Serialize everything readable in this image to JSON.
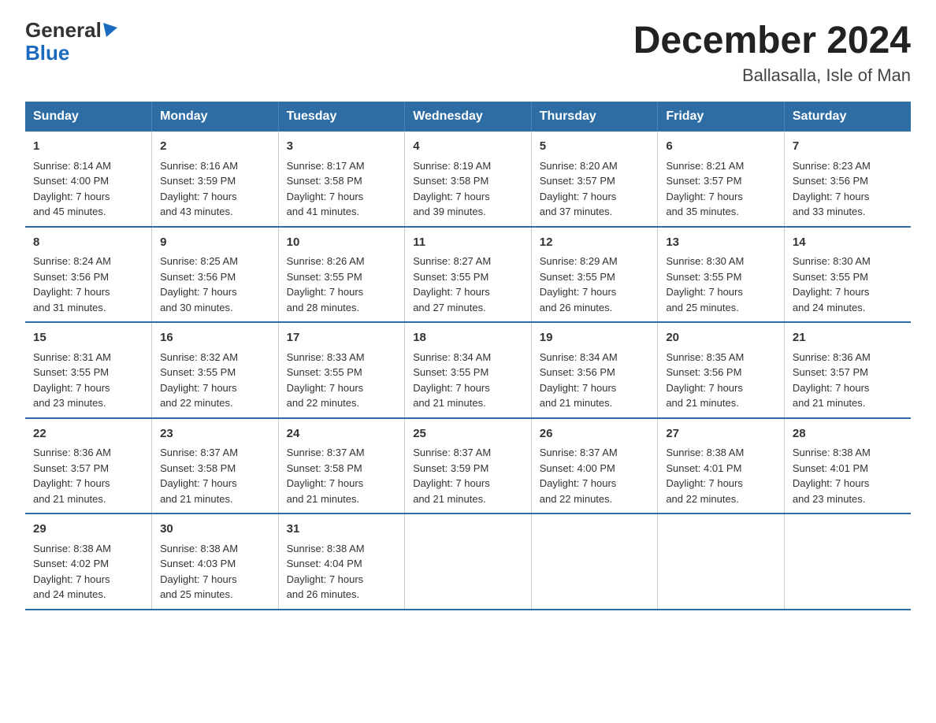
{
  "header": {
    "logo_line1": "General",
    "logo_line2": "Blue",
    "title": "December 2024",
    "location": "Ballasalla, Isle of Man"
  },
  "columns": [
    "Sunday",
    "Monday",
    "Tuesday",
    "Wednesday",
    "Thursday",
    "Friday",
    "Saturday"
  ],
  "weeks": [
    [
      {
        "day": "1",
        "sunrise": "8:14 AM",
        "sunset": "4:00 PM",
        "daylight": "7 hours and 45 minutes."
      },
      {
        "day": "2",
        "sunrise": "8:16 AM",
        "sunset": "3:59 PM",
        "daylight": "7 hours and 43 minutes."
      },
      {
        "day": "3",
        "sunrise": "8:17 AM",
        "sunset": "3:58 PM",
        "daylight": "7 hours and 41 minutes."
      },
      {
        "day": "4",
        "sunrise": "8:19 AM",
        "sunset": "3:58 PM",
        "daylight": "7 hours and 39 minutes."
      },
      {
        "day": "5",
        "sunrise": "8:20 AM",
        "sunset": "3:57 PM",
        "daylight": "7 hours and 37 minutes."
      },
      {
        "day": "6",
        "sunrise": "8:21 AM",
        "sunset": "3:57 PM",
        "daylight": "7 hours and 35 minutes."
      },
      {
        "day": "7",
        "sunrise": "8:23 AM",
        "sunset": "3:56 PM",
        "daylight": "7 hours and 33 minutes."
      }
    ],
    [
      {
        "day": "8",
        "sunrise": "8:24 AM",
        "sunset": "3:56 PM",
        "daylight": "7 hours and 31 minutes."
      },
      {
        "day": "9",
        "sunrise": "8:25 AM",
        "sunset": "3:56 PM",
        "daylight": "7 hours and 30 minutes."
      },
      {
        "day": "10",
        "sunrise": "8:26 AM",
        "sunset": "3:55 PM",
        "daylight": "7 hours and 28 minutes."
      },
      {
        "day": "11",
        "sunrise": "8:27 AM",
        "sunset": "3:55 PM",
        "daylight": "7 hours and 27 minutes."
      },
      {
        "day": "12",
        "sunrise": "8:29 AM",
        "sunset": "3:55 PM",
        "daylight": "7 hours and 26 minutes."
      },
      {
        "day": "13",
        "sunrise": "8:30 AM",
        "sunset": "3:55 PM",
        "daylight": "7 hours and 25 minutes."
      },
      {
        "day": "14",
        "sunrise": "8:30 AM",
        "sunset": "3:55 PM",
        "daylight": "7 hours and 24 minutes."
      }
    ],
    [
      {
        "day": "15",
        "sunrise": "8:31 AM",
        "sunset": "3:55 PM",
        "daylight": "7 hours and 23 minutes."
      },
      {
        "day": "16",
        "sunrise": "8:32 AM",
        "sunset": "3:55 PM",
        "daylight": "7 hours and 22 minutes."
      },
      {
        "day": "17",
        "sunrise": "8:33 AM",
        "sunset": "3:55 PM",
        "daylight": "7 hours and 22 minutes."
      },
      {
        "day": "18",
        "sunrise": "8:34 AM",
        "sunset": "3:55 PM",
        "daylight": "7 hours and 21 minutes."
      },
      {
        "day": "19",
        "sunrise": "8:34 AM",
        "sunset": "3:56 PM",
        "daylight": "7 hours and 21 minutes."
      },
      {
        "day": "20",
        "sunrise": "8:35 AM",
        "sunset": "3:56 PM",
        "daylight": "7 hours and 21 minutes."
      },
      {
        "day": "21",
        "sunrise": "8:36 AM",
        "sunset": "3:57 PM",
        "daylight": "7 hours and 21 minutes."
      }
    ],
    [
      {
        "day": "22",
        "sunrise": "8:36 AM",
        "sunset": "3:57 PM",
        "daylight": "7 hours and 21 minutes."
      },
      {
        "day": "23",
        "sunrise": "8:37 AM",
        "sunset": "3:58 PM",
        "daylight": "7 hours and 21 minutes."
      },
      {
        "day": "24",
        "sunrise": "8:37 AM",
        "sunset": "3:58 PM",
        "daylight": "7 hours and 21 minutes."
      },
      {
        "day": "25",
        "sunrise": "8:37 AM",
        "sunset": "3:59 PM",
        "daylight": "7 hours and 21 minutes."
      },
      {
        "day": "26",
        "sunrise": "8:37 AM",
        "sunset": "4:00 PM",
        "daylight": "7 hours and 22 minutes."
      },
      {
        "day": "27",
        "sunrise": "8:38 AM",
        "sunset": "4:01 PM",
        "daylight": "7 hours and 22 minutes."
      },
      {
        "day": "28",
        "sunrise": "8:38 AM",
        "sunset": "4:01 PM",
        "daylight": "7 hours and 23 minutes."
      }
    ],
    [
      {
        "day": "29",
        "sunrise": "8:38 AM",
        "sunset": "4:02 PM",
        "daylight": "7 hours and 24 minutes."
      },
      {
        "day": "30",
        "sunrise": "8:38 AM",
        "sunset": "4:03 PM",
        "daylight": "7 hours and 25 minutes."
      },
      {
        "day": "31",
        "sunrise": "8:38 AM",
        "sunset": "4:04 PM",
        "daylight": "7 hours and 26 minutes."
      },
      null,
      null,
      null,
      null
    ]
  ],
  "labels": {
    "sunrise": "Sunrise:",
    "sunset": "Sunset:",
    "daylight": "Daylight:"
  }
}
